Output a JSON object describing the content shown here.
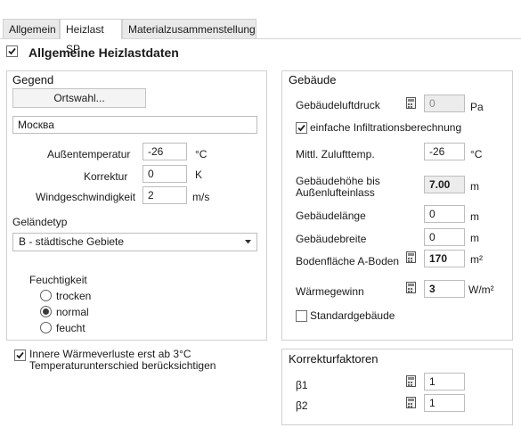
{
  "tabs": [
    {
      "label": "Allgemein"
    },
    {
      "label": "Heizlast SP"
    },
    {
      "label": "Materialzusammenstellung"
    }
  ],
  "section_title": "Allgemeine Heizlastdaten",
  "gegend": {
    "title": "Gegend",
    "ortswahl_button": "Ortswahl...",
    "location": "Москва",
    "aussentemp": {
      "label": "Außentemperatur",
      "value": "-26",
      "unit": "°C"
    },
    "korrektur": {
      "label": "Korrektur",
      "value": "0",
      "unit": "K"
    },
    "wind": {
      "label": "Windgeschwindigkeit",
      "value": "2",
      "unit": "m/s"
    },
    "gelaendetyp_label": "Geländetyp",
    "gelaendetyp_value": "B - städtische Gebiete",
    "feuchtigkeit_label": "Feuchtigkeit",
    "feuchte_options": [
      {
        "label": "trocken",
        "selected": false
      },
      {
        "label": "normal",
        "selected": true
      },
      {
        "label": "feucht",
        "selected": false
      }
    ]
  },
  "innere_check": {
    "line1": "Innere Wärmeverluste erst ab 3°C",
    "line2": "Temperaturunterschied berücksichtigen",
    "checked": true
  },
  "gebaeude": {
    "title": "Gebäude",
    "luftdruck": {
      "label": "Gebäudeluftdruck",
      "value": "0",
      "unit": "Pa"
    },
    "infiltration": {
      "label": "einfache Infiltrationsberechnung",
      "checked": true
    },
    "zuluft": {
      "label": "Mittl. Zulufttemp.",
      "value": "-26",
      "unit": "°C"
    },
    "hoehe": {
      "label1": "Gebäudehöhe bis",
      "label2": "Außenlufteinlass",
      "value": "7.00",
      "unit": "m"
    },
    "laenge": {
      "label": "Gebäudelänge",
      "value": "0",
      "unit": "m"
    },
    "breite": {
      "label": "Gebäudebreite",
      "value": "0",
      "unit": "m"
    },
    "bodenflaeche": {
      "label": "Bodenfläche A-Boden",
      "value": "170",
      "unit": "m²"
    },
    "waermegewinn": {
      "label": "Wärmegewinn",
      "value": "3",
      "unit": "W/m²"
    },
    "standard": {
      "label": "Standardgebäude",
      "checked": false
    }
  },
  "korrektur": {
    "title": "Korrekturfaktoren",
    "beta1": {
      "label": "β1",
      "value": "1"
    },
    "beta2": {
      "label": "β2",
      "value": "1"
    }
  }
}
